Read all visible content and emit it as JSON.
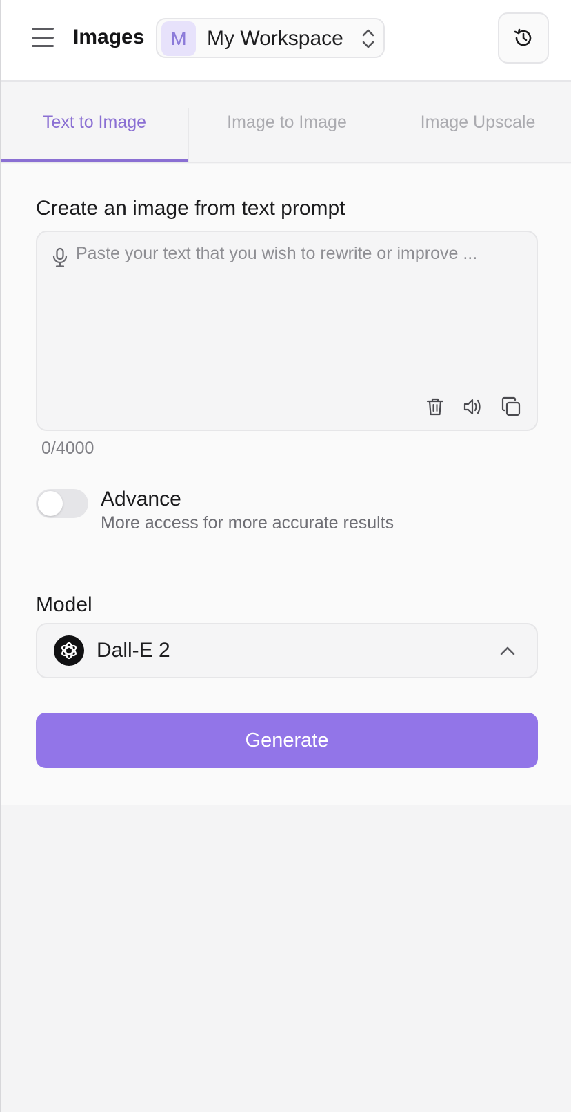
{
  "header": {
    "menu_icon": "hamburger-menu-icon",
    "title": "Images",
    "workspace": {
      "avatar_letter": "M",
      "name": "My Workspace",
      "switch_icon": "chevron-up-down-icon"
    },
    "history_icon": "history-clock-icon"
  },
  "tabs": [
    {
      "label": "Text to Image",
      "active": true
    },
    {
      "label": "Image to Image",
      "active": false
    },
    {
      "label": "Image Upscale",
      "active": false
    }
  ],
  "form": {
    "section_title": "Create an image from text prompt",
    "prompt": {
      "value": "",
      "placeholder": "Paste your text that you wish to rewrite or improve ...",
      "mic_icon": "microphone-icon",
      "actions": [
        "trash-icon",
        "speaker-icon",
        "copy-icon"
      ]
    },
    "char_count": "0/4000",
    "advance": {
      "label": "Advance",
      "description": "More access for more accurate results",
      "enabled": false
    },
    "model": {
      "label": "Model",
      "selected": "Dall-E 2",
      "logo_icon": "openai-logo-icon",
      "chevron_icon": "chevron-up-icon"
    },
    "generate_label": "Generate"
  },
  "colors": {
    "accent": "#9275e8",
    "tab_active": "#8a6fd3",
    "tab_inactive": "#ababb0"
  }
}
